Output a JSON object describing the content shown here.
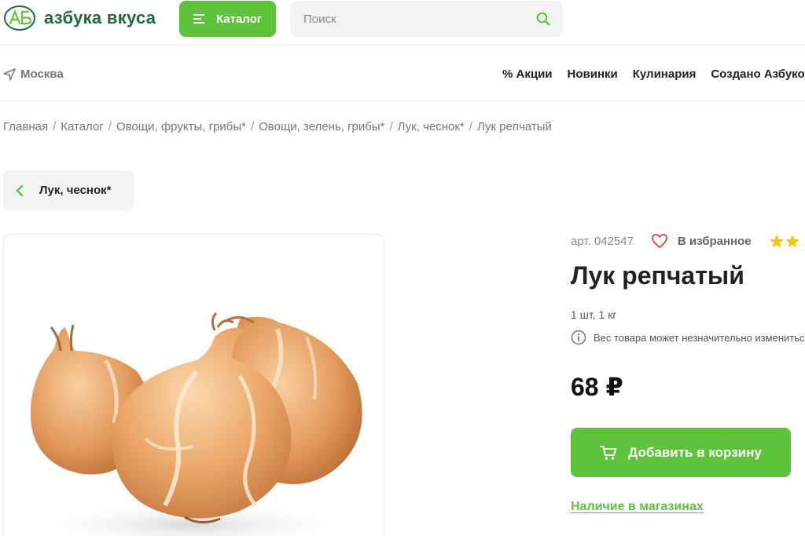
{
  "header": {
    "logo_text": "азбука вкуса",
    "catalog_label": "Каталог",
    "search_placeholder": "Поиск"
  },
  "subbar": {
    "city": "Москва",
    "nav": [
      "% Акции",
      "Новинки",
      "Кулинария",
      "Создано Азбукой"
    ]
  },
  "breadcrumb": [
    "Главная",
    "Каталог",
    "Овощи, фрукты, грибы*",
    "Овощи, зелень, грибы*",
    "Лук, чеснок*",
    "Лук репчатый"
  ],
  "back_chip": {
    "label": "Лук, чеснок*"
  },
  "product": {
    "sku": "арт. 042547",
    "favorite_label": "В избранное",
    "title": "Лук репчатый",
    "weight": "1 шт, 1 кг",
    "note": "Вес товара может незначительно измениться",
    "price": "68 ₽",
    "add_to_cart_label": "Добавить в корзину",
    "availability_link": "Наличие в магазинах"
  },
  "colors": {
    "brand_green": "#5fc23c",
    "logo_green": "#1f6b38",
    "star_yellow": "#f5c518",
    "heart_red": "#d8434b"
  },
  "icons": {
    "logo": "azbuka-logo-icon",
    "menu": "menu-icon",
    "search": "search-icon",
    "location": "location-arrow-icon",
    "back": "chevron-left-icon",
    "favorite": "heart-icon",
    "rating": "star-icon",
    "info": "info-icon",
    "cart": "cart-icon"
  }
}
